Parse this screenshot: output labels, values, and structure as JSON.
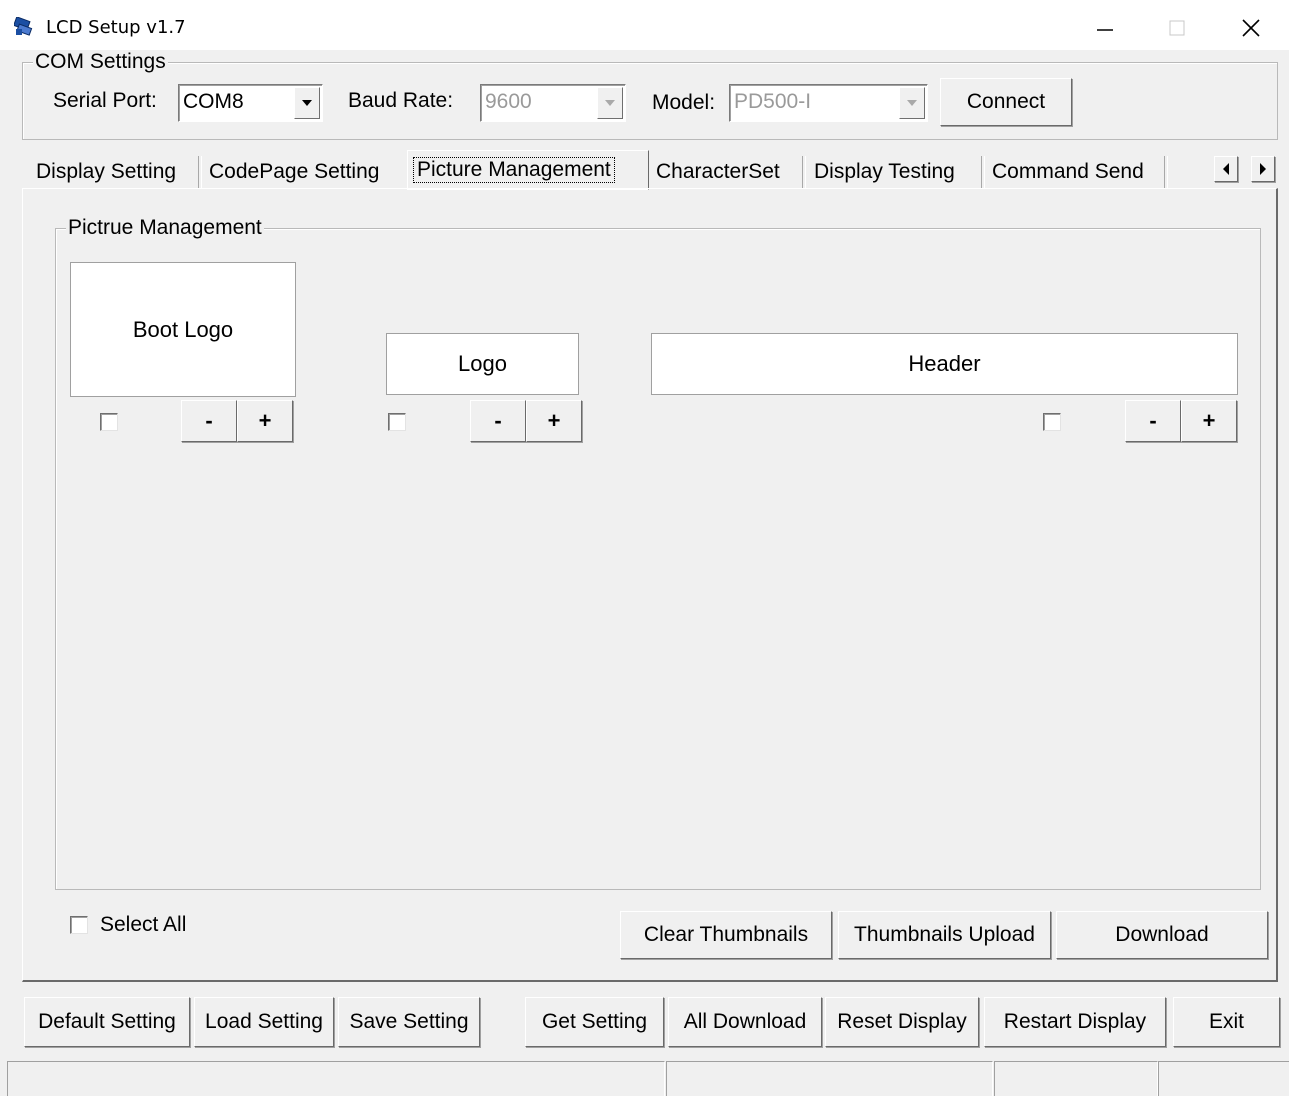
{
  "window": {
    "title": "LCD Setup v1.7",
    "controls": {
      "minimize": "—",
      "maximize": "☐",
      "close": "✕"
    }
  },
  "com_settings": {
    "legend": "COM Settings",
    "serial_port_label": "Serial Port:",
    "serial_port_value": "COM8",
    "baud_rate_label": "Baud Rate:",
    "baud_rate_value": "9600",
    "model_label": "Model:",
    "model_value": "PD500-I",
    "connect_label": "Connect"
  },
  "tabs": {
    "display_setting": "Display Setting",
    "codepage_setting": "CodePage Setting",
    "picture_management": "Picture Management",
    "characterset": "CharacterSet",
    "display_testing": "Display Testing",
    "command_send": "Command Send",
    "active": "picture_management"
  },
  "picture_panel": {
    "legend": "Pictrue Management",
    "boot_logo": {
      "label": "Boot Logo",
      "minus": "-",
      "plus": "+"
    },
    "logo": {
      "label": "Logo",
      "minus": "-",
      "plus": "+"
    },
    "header": {
      "label": "Header",
      "minus": "-",
      "plus": "+"
    },
    "select_all_label": "Select All",
    "clear_thumbnails_label": "Clear Thumbnails",
    "thumbnails_upload_label": "Thumbnails Upload",
    "download_label": "Download"
  },
  "bottom_bar": {
    "default_setting": "Default Setting",
    "load_setting": "Load Setting",
    "save_setting": "Save Setting",
    "get_setting": "Get Setting",
    "all_download": "All Download",
    "reset_display": "Reset Display",
    "restart_display": "Restart Display",
    "exit": "Exit"
  },
  "icons": {
    "app": "lcd-app-icon",
    "scroll_left": "arrow-left-icon",
    "scroll_right": "arrow-right-icon",
    "dropdown": "chevron-down-icon"
  }
}
